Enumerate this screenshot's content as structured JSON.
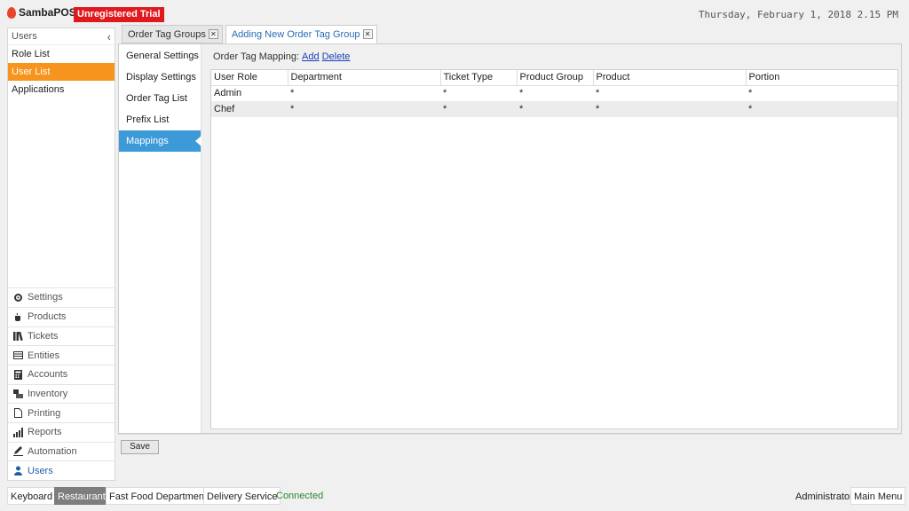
{
  "header": {
    "brand": "SambaPOS",
    "trial_badge": "Unregistered Trial",
    "datetime": "Thursday, February 1, 2018 2.15 PM"
  },
  "leftnav": {
    "section_title": "Users",
    "collapse_glyph": "‹",
    "items": [
      {
        "label": "Role List"
      },
      {
        "label": "User List"
      },
      {
        "label": "Applications"
      }
    ],
    "modules": [
      {
        "label": "Settings",
        "icon": "gear-icon"
      },
      {
        "label": "Products",
        "icon": "coffee-icon"
      },
      {
        "label": "Tickets",
        "icon": "books-icon"
      },
      {
        "label": "Entities",
        "icon": "table-icon"
      },
      {
        "label": "Accounts",
        "icon": "calculator-icon"
      },
      {
        "label": "Inventory",
        "icon": "boxes-icon"
      },
      {
        "label": "Printing",
        "icon": "document-icon"
      },
      {
        "label": "Reports",
        "icon": "bar-chart-icon"
      },
      {
        "label": "Automation",
        "icon": "pen-icon"
      },
      {
        "label": "Users",
        "icon": "user-icon"
      }
    ]
  },
  "tabs": [
    {
      "label": "Order Tag Groups"
    },
    {
      "label": "Adding New Order Tag Group"
    }
  ],
  "side_menu": [
    {
      "label": "General Settings"
    },
    {
      "label": "Display Settings"
    },
    {
      "label": "Order Tag List"
    },
    {
      "label": "Prefix List"
    },
    {
      "label": "Mappings"
    }
  ],
  "mapping": {
    "label": "Order Tag Mapping:",
    "add": "Add",
    "delete": "Delete"
  },
  "grid": {
    "columns": [
      "User Role",
      "Department",
      "Ticket Type",
      "Product Group",
      "Product",
      "Portion"
    ],
    "rows": [
      [
        "Admin",
        "*",
        "*",
        "*",
        "*",
        "*"
      ],
      [
        "Chef",
        "*",
        "*",
        "*",
        "*",
        "*"
      ]
    ]
  },
  "save_label": "Save",
  "statusbar": {
    "keyboard": "Keyboard",
    "restaurant": "Restaurant",
    "department": "Fast Food Department",
    "delivery": "Delivery Service",
    "connected": "Connected",
    "user": "Administrator",
    "main_menu": "Main Menu"
  },
  "colors": {
    "accent_orange": "#f7941d",
    "accent_blue": "#3c9ad8",
    "trial_red": "#e0191e",
    "connected_green": "#2a8a2a"
  }
}
